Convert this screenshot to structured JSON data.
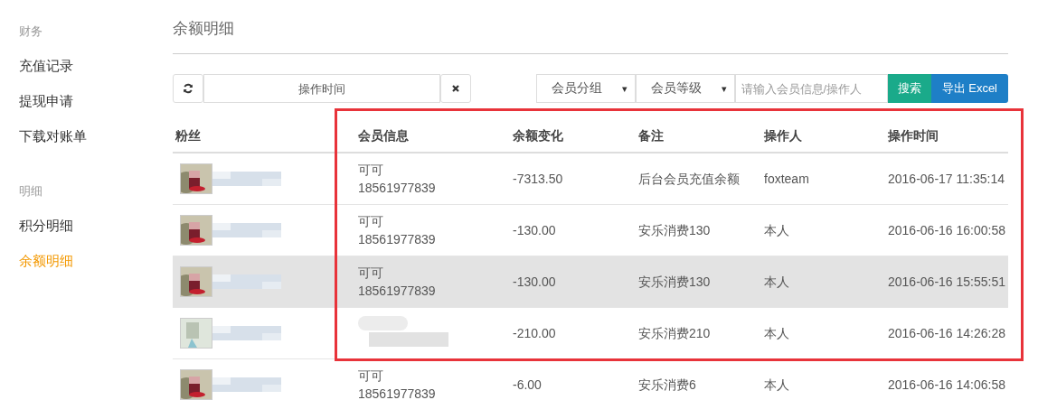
{
  "sidebar": {
    "groups": [
      {
        "heading": "财务",
        "items": [
          {
            "label": "充值记录",
            "selected": false
          },
          {
            "label": "提现申请",
            "selected": false
          },
          {
            "label": "下载对账单",
            "selected": false
          }
        ]
      },
      {
        "heading": "明细",
        "items": [
          {
            "label": "积分明细",
            "selected": false
          },
          {
            "label": "余额明细",
            "selected": true
          }
        ]
      }
    ]
  },
  "page_title": "余额明细",
  "toolbar": {
    "date_range": {
      "placeholder": "操作时间"
    },
    "member_group": {
      "label": "会员分组",
      "caret": "▾"
    },
    "member_level": {
      "label": "会员等级",
      "caret": "▾"
    },
    "search": {
      "placeholder": "请输入会员信息/操作人"
    },
    "search_button": "搜索",
    "export_button": "导出 Excel"
  },
  "table": {
    "columns": [
      "粉丝",
      "会员信息",
      "余额变化",
      "备注",
      "操作人",
      "操作时间"
    ],
    "rows": [
      {
        "member_name": "可可",
        "member_phone": "18561977839",
        "change": "-7313.50",
        "remark": "后台会员充值余额",
        "operator": "foxteam",
        "time": "2016-06-17 11:35:14",
        "selected": false
      },
      {
        "member_name": "可可",
        "member_phone": "18561977839",
        "change": "-130.00",
        "remark": "安乐消费130",
        "operator": "本人",
        "time": "2016-06-16 16:00:58",
        "selected": false
      },
      {
        "member_name": "可可",
        "member_phone": "18561977839",
        "change": "-130.00",
        "remark": "安乐消费130",
        "operator": "本人",
        "time": "2016-06-16 15:55:51",
        "selected": true
      },
      {
        "change": "-210.00",
        "remark": "安乐消费210",
        "operator": "本人",
        "time": "2016-06-16 14:26:28",
        "selected": false
      },
      {
        "member_name": "可可",
        "member_phone": "18561977839",
        "change": "-6.00",
        "remark": "安乐消费6",
        "operator": "本人",
        "time": "2016-06-16 14:06:58",
        "selected": false
      }
    ]
  }
}
